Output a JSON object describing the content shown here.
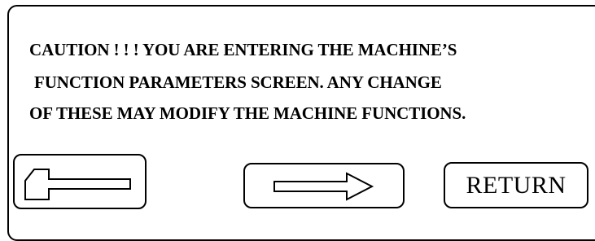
{
  "warning": {
    "line1": "CAUTION ! ! ! YOU ARE ENTERING THE MACHINE’S",
    "line2": "FUNCTION PARAMETERS SCREEN. ANY CHANGE",
    "line3": "OF THESE MAY MODIFY THE MACHINE FUNCTIONS."
  },
  "buttons": {
    "hammer_icon": "hammer-icon",
    "arrow_icon": "right-arrow-icon",
    "return_label": "RETURN"
  },
  "colors": {
    "foreground": "#000000",
    "background": "#ffffff"
  }
}
